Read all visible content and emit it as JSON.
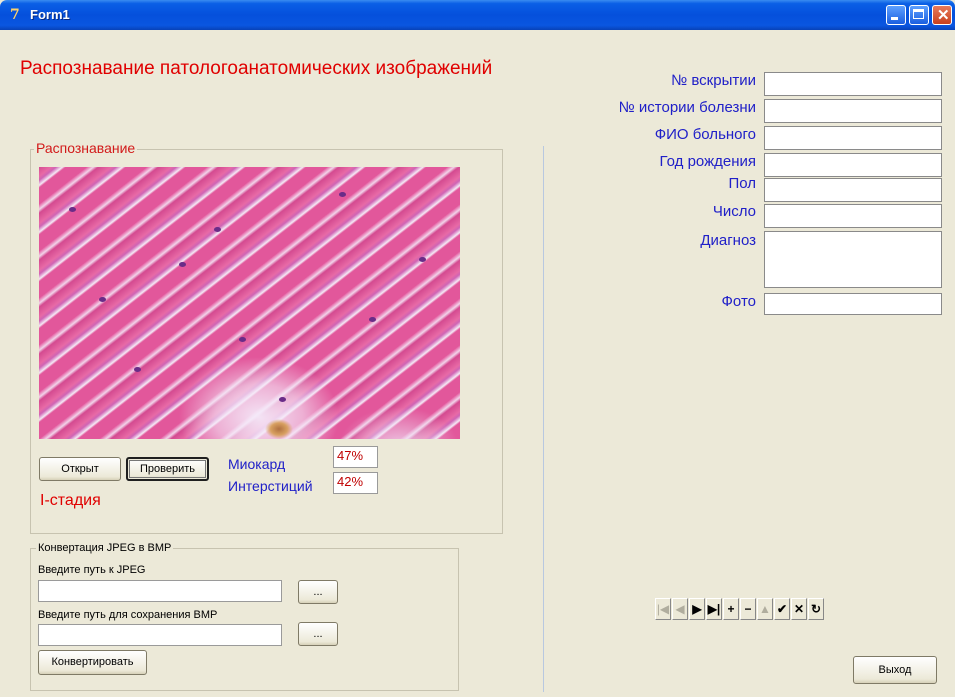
{
  "window": {
    "icon": "delphi-app-icon",
    "title": "Form1",
    "controls": [
      "minimize-icon",
      "maximize-icon",
      "close-icon"
    ]
  },
  "heading": "Распознавание патологоанатомических изображений",
  "recognition": {
    "group_caption": "Распознавание",
    "open_button": "Открыт",
    "check_button": "Проверить",
    "myocardium_label": "Миокард",
    "myocardium_value": "47%",
    "interstitium_label": "Интерстиций",
    "interstitium_value": "42%",
    "stage": "I-стадия"
  },
  "conversion": {
    "group_caption": "Конвертация JPEG в BMP",
    "jpeg_path_label": "Введите путь к JPEG",
    "jpeg_path_value": "",
    "browse_jpeg": "...",
    "bmp_path_label": "Введите путь для сохранения BMP",
    "bmp_path_value": "",
    "browse_bmp": "...",
    "convert_button": "Конвертировать"
  },
  "record_form": {
    "autopsy_no_label": "№ вскрытии",
    "history_no_label": "№ истории болезни",
    "patient_name_label": "ФИО больного",
    "birth_year_label": "Год рождения",
    "sex_label": "Пол",
    "date_label": "Число",
    "diagnosis_label": "Диагноз",
    "photo_label": "Фото"
  },
  "navigator": {
    "buttons": [
      {
        "name": "first-record-icon",
        "glyph": "|◀",
        "enabled": false
      },
      {
        "name": "prior-record-icon",
        "glyph": "◀",
        "enabled": false
      },
      {
        "name": "next-record-icon",
        "glyph": "▶",
        "enabled": true
      },
      {
        "name": "last-record-icon",
        "glyph": "▶|",
        "enabled": true
      },
      {
        "name": "insert-record-icon",
        "glyph": "+",
        "enabled": true
      },
      {
        "name": "delete-record-icon",
        "glyph": "−",
        "enabled": true
      },
      {
        "name": "edit-record-icon",
        "glyph": "▲",
        "enabled": false
      },
      {
        "name": "post-record-icon",
        "glyph": "✔",
        "enabled": true
      },
      {
        "name": "cancel-record-icon",
        "glyph": "✕",
        "enabled": true
      },
      {
        "name": "refresh-icon",
        "glyph": "↻",
        "enabled": true
      }
    ]
  },
  "exit_button": "Выход",
  "colors": {
    "heading": "#e00000",
    "label_blue": "#2020c8",
    "titlebar": "#0550dc",
    "background": "#ece9d8"
  }
}
